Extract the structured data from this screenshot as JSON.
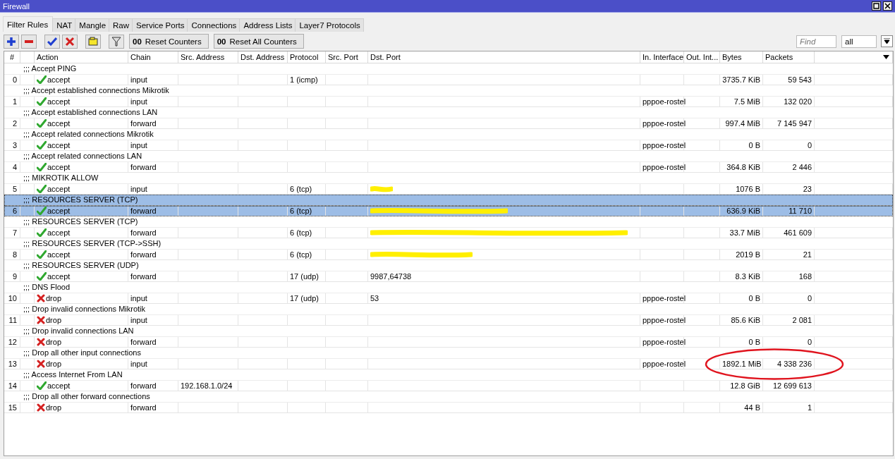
{
  "window": {
    "title": "Firewall"
  },
  "tabs": [
    {
      "label": "Filter Rules",
      "selected": true
    },
    {
      "label": "NAT",
      "selected": false
    },
    {
      "label": "Mangle",
      "selected": false
    },
    {
      "label": "Raw",
      "selected": false
    },
    {
      "label": "Service Ports",
      "selected": false
    },
    {
      "label": "Connections",
      "selected": false
    },
    {
      "label": "Address Lists",
      "selected": false
    },
    {
      "label": "Layer7 Protocols",
      "selected": false
    }
  ],
  "toolbar": {
    "icon_buttons": [
      {
        "kind": "add"
      },
      {
        "kind": "remove"
      },
      {
        "kind": "enable"
      },
      {
        "kind": "disable"
      },
      {
        "kind": "comment"
      },
      {
        "kind": "filter"
      }
    ],
    "reset_buttons": [
      {
        "prefix": "00",
        "label": "Reset Counters"
      },
      {
        "prefix": "00",
        "label": "Reset All Counters"
      }
    ],
    "find": {
      "placeholder": "Find"
    },
    "scope": {
      "value": "all"
    }
  },
  "table": {
    "columns": [
      "#",
      "Action",
      "Chain",
      "Src. Address",
      "Dst. Address",
      "Protocol",
      "Src. Port",
      "Dst. Port",
      "In. Interface",
      "Out. Int...",
      "Bytes",
      "Packets"
    ],
    "rules": [
      {
        "comment": ";;; Accept PING",
        "number": "0",
        "kind": "accept",
        "action": "accept",
        "chain": "input",
        "protocol": "1 (icmp)",
        "bytes": "3735.7 KiB",
        "packets": "59 543",
        "selected": false
      },
      {
        "comment": ";;; Accept established connections Mikrotik",
        "number": "1",
        "kind": "accept",
        "action": "accept",
        "chain": "input",
        "in_interface": "pppoe-rostel",
        "bytes": "7.5 MiB",
        "packets": "132 020",
        "selected": false
      },
      {
        "comment": ";;; Accept established connections LAN",
        "number": "2",
        "kind": "accept",
        "action": "accept",
        "chain": "forward",
        "in_interface": "pppoe-rostel",
        "bytes": "997.4 MiB",
        "packets": "7 145 947",
        "selected": false
      },
      {
        "comment": ";;; Accept related connections Mikrotik",
        "number": "3",
        "kind": "accept",
        "action": "accept",
        "chain": "input",
        "in_interface": "pppoe-rostel",
        "bytes": "0 B",
        "packets": "0",
        "selected": false
      },
      {
        "comment": ";;; Accept related connections LAN",
        "number": "4",
        "kind": "accept",
        "action": "accept",
        "chain": "forward",
        "in_interface": "pppoe-rostel",
        "bytes": "364.8 KiB",
        "packets": "2 446",
        "selected": false
      },
      {
        "comment": ";;; MIKROTIK ALLOW",
        "number": "5",
        "kind": "accept",
        "action": "accept",
        "chain": "input",
        "protocol": "6 (tcp)",
        "dst_port_redacted": true,
        "bytes": "1076 B",
        "packets": "23",
        "selected": false
      },
      {
        "comment": ";;; RESOURCES SERVER (TCP)",
        "number": "6",
        "kind": "accept",
        "action": "accept",
        "chain": "forward",
        "protocol": "6 (tcp)",
        "dst_port_redacted": true,
        "bytes": "636.9 KiB",
        "packets": "11 710",
        "selected": true
      },
      {
        "comment": ";;; RESOURCES SERVER (TCP)",
        "number": "7",
        "kind": "accept",
        "action": "accept",
        "chain": "forward",
        "protocol": "6 (tcp)",
        "dst_port_redacted": true,
        "bytes": "33.7 MiB",
        "packets": "461 609",
        "selected": false
      },
      {
        "comment": ";;; RESOURCES SERVER (TCP->SSH)",
        "number": "8",
        "kind": "accept",
        "action": "accept",
        "chain": "forward",
        "protocol": "6 (tcp)",
        "dst_port_redacted": true,
        "bytes": "2019 B",
        "packets": "21",
        "selected": false
      },
      {
        "comment": ";;; RESOURCES SERVER (UDP)",
        "number": "9",
        "kind": "accept",
        "action": "accept",
        "chain": "forward",
        "protocol": "17 (udp)",
        "dst_port": "9987,64738",
        "bytes": "8.3 KiB",
        "packets": "168",
        "selected": false
      },
      {
        "comment": ";;; DNS Flood",
        "number": "10",
        "kind": "drop",
        "action": "drop",
        "chain": "input",
        "protocol": "17 (udp)",
        "dst_port": "53",
        "in_interface": "pppoe-rostel",
        "bytes": "0 B",
        "packets": "0",
        "selected": false
      },
      {
        "comment": ";;; Drop invalid connections Mikrotik",
        "number": "11",
        "kind": "drop",
        "action": "drop",
        "chain": "input",
        "in_interface": "pppoe-rostel",
        "bytes": "85.6 KiB",
        "packets": "2 081",
        "selected": false
      },
      {
        "comment": ";;; Drop invalid connections LAN",
        "number": "12",
        "kind": "drop",
        "action": "drop",
        "chain": "forward",
        "in_interface": "pppoe-rostel",
        "bytes": "0 B",
        "packets": "0",
        "selected": false
      },
      {
        "comment": ";;; Drop all other input connections",
        "number": "13",
        "kind": "drop",
        "action": "drop",
        "chain": "input",
        "in_interface": "pppoe-rostel",
        "bytes": "1892.1 MiB",
        "packets": "4 338 236",
        "circled": true,
        "selected": false
      },
      {
        "comment": ";;; Access Internet From LAN",
        "number": "14",
        "kind": "accept",
        "action": "accept",
        "chain": "forward",
        "src_address": "192.168.1.0/24",
        "bytes": "12.8 GiB",
        "packets": "12 699 613",
        "selected": false
      },
      {
        "comment": ";;; Drop all other forward connections",
        "number": "15",
        "kind": "drop",
        "action": "drop",
        "chain": "forward",
        "bytes": "44 B",
        "packets": "1",
        "selected": false
      }
    ]
  }
}
